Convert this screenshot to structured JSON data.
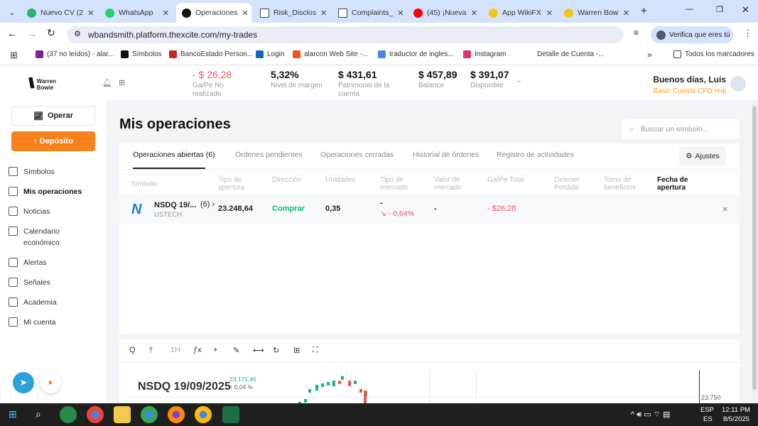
{
  "browser": {
    "tabs": [
      {
        "label": "Nuevo CV (2",
        "color": "#29b36b"
      },
      {
        "label": "WhatsApp",
        "color": "#25d366"
      },
      {
        "label": "Operaciones",
        "color": "#111",
        "active": true
      },
      {
        "label": "Risk_Disclos",
        "color": "#fff"
      },
      {
        "label": "Complaints_",
        "color": "#fff"
      },
      {
        "label": "(45) ¡Nueva",
        "color": "#ff0000"
      },
      {
        "label": "App WikiFX",
        "color": "#f5c518"
      },
      {
        "label": "Warren Bow",
        "color": "#f5c518"
      }
    ],
    "url": "wbandsmith.platform.thexcite.com/my-trades",
    "profile_label": "Verifica que eres tú",
    "bookmarks": [
      "(37 no leídos) - alar...",
      "Símbolos",
      "BancoEstado Person...",
      "Login",
      "alarcon Web Site -...",
      "traductor de ingles...",
      "Instagram",
      "Detalle de Cuenta -..."
    ],
    "all_bookmarks": "Todos los marcadores",
    "more_bookmarks": "»"
  },
  "header": {
    "logo_text": "Warren Bowie",
    "stats": [
      {
        "value": "- $ 26,28",
        "label": "Ga/Pe No realizado",
        "negative": true
      },
      {
        "value": "5,32%",
        "label": "Nivel de margen"
      },
      {
        "value": "$ 431,61",
        "label": "Patrimonio de la cuenta"
      },
      {
        "value": "$ 457,89",
        "label": "Balance"
      },
      {
        "value": "$ 391,07",
        "label": "Disponible"
      }
    ],
    "greeting": "Buenos días, Luis",
    "account": "Basic Cuenta CFD real"
  },
  "sidebar": {
    "operate": "Operar",
    "deposit": "↑ Depósito",
    "items": [
      "Símbolos",
      "Mis operaciones",
      "Noticias",
      "Calendario económico",
      "Alertas",
      "Señales",
      "Academia",
      "Mi cuenta"
    ]
  },
  "main": {
    "title": "Mis operaciones",
    "search_placeholder": "Buscar un símbolo...",
    "tabs": [
      "Operaciones abiertas (6)",
      "Ordenes pendientes",
      "Operaciones cerradas",
      "Historial de órdenes",
      "Registro de actividades"
    ],
    "settings": "Ajustes",
    "columns": [
      "Símbolo",
      "Tipo de apertura",
      "Dirección",
      "Unidades",
      "Tipo de mercado",
      "Valor de mercado",
      "Ga/Pe Total",
      "Detener Perdida",
      "Toma de beneficios",
      "Fecha de apertura"
    ],
    "rows": [
      {
        "symbol": "NSDQ 19/...",
        "count": "(6) ›",
        "sub": "USTECH",
        "open": "23.248,64",
        "direction": "Comprar",
        "units": "0,35",
        "market_type": "-",
        "change": "↘ - 0,64%",
        "market_value": "-",
        "pnl": "- $26,28",
        "close": "×"
      }
    ]
  },
  "chart": {
    "toolbar": [
      "Q",
      "⫯",
      "1H",
      "ƒx",
      "+",
      "✎",
      "⟷",
      "↻",
      "⊞",
      "⛶"
    ],
    "symbol": "NSDQ 19/09/2025",
    "price": "23.171,45",
    "change": "↑ 0,04 %",
    "axis_label": "23.750"
  },
  "taskbar": {
    "lang": "ESP",
    "lang2": "ES",
    "time": "12:11 PM",
    "date": "8/5/2025"
  },
  "colors": {
    "accent": "#f7821b",
    "positive": "#16b777",
    "negative": "#f0525c"
  }
}
